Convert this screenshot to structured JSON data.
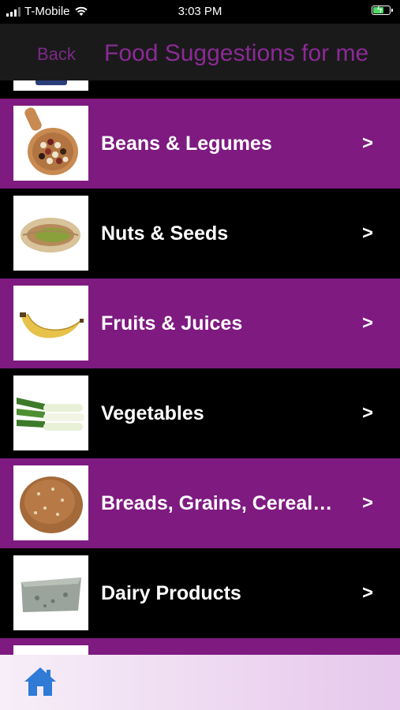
{
  "status_bar": {
    "carrier": "T-Mobile",
    "time": "3:03 PM"
  },
  "nav": {
    "back_label": "Back",
    "title": "Food Suggestions for me"
  },
  "list": {
    "items": [
      {
        "label": "Beans & Legumes",
        "icon": "beans-spoon-icon"
      },
      {
        "label": "Nuts & Seeds",
        "icon": "pistachio-icon"
      },
      {
        "label": "Fruits & Juices",
        "icon": "banana-icon"
      },
      {
        "label": "Vegetables",
        "icon": "leek-icon"
      },
      {
        "label": "Breads, Grains, Cereal…",
        "icon": "bread-loaf-icon"
      },
      {
        "label": "Dairy Products",
        "icon": "cheese-icon"
      }
    ],
    "chevron": ">"
  },
  "tab_bar": {
    "home_icon": "home-icon"
  },
  "colors": {
    "accent_purple": "#7e1a80",
    "title_purple": "#8b2a96",
    "home_blue": "#2f7bd6"
  }
}
